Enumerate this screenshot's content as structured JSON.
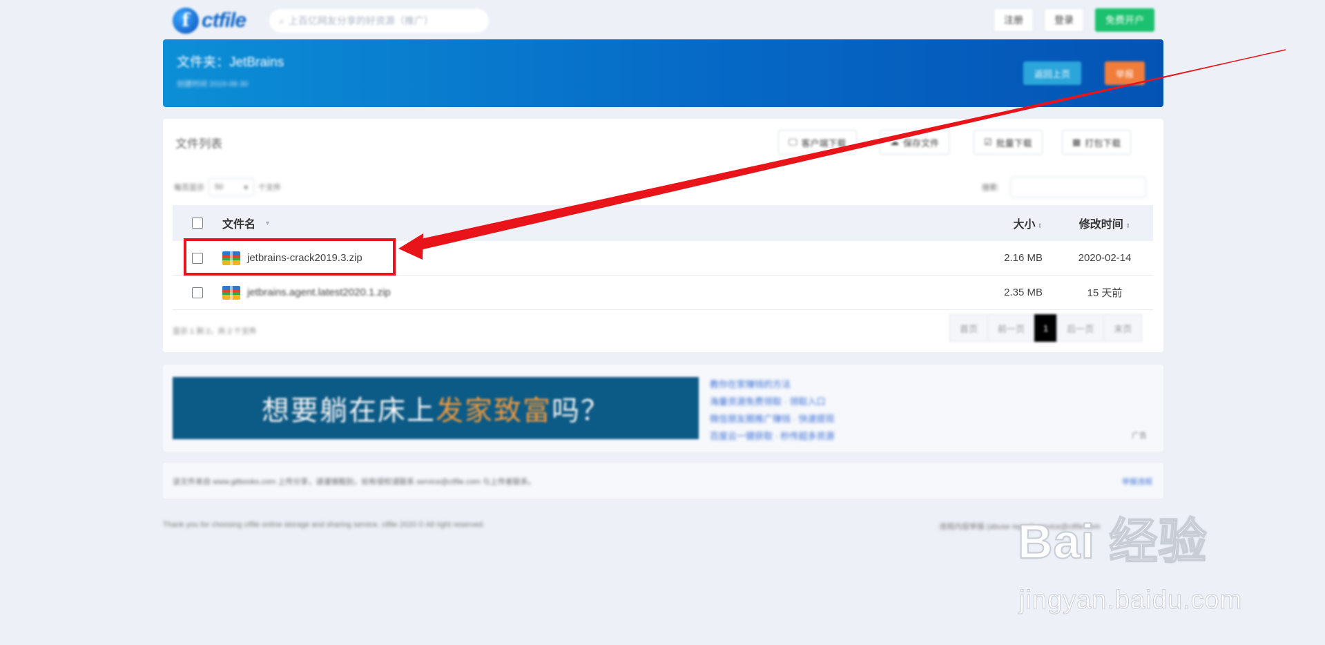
{
  "header": {
    "logo_letter": "f",
    "logo_text": "ctfile",
    "search_placeholder": "上百亿网友分享的好资源（推广）",
    "register_label": "注册",
    "login_label": "登录",
    "open_account_label": "免费开户"
  },
  "banner": {
    "title": "文件夹：JetBrains",
    "subtitle": "创建时间 2019-08-30",
    "back_label": "返回上页",
    "report_label": "举报"
  },
  "panel": {
    "title": "文件列表",
    "buttons": {
      "client_download": "客户端下载",
      "save_file": "保存文件",
      "batch_download": "批量下载",
      "package_download": "打包下载"
    },
    "length_prefix": "每页显示",
    "length_value": "50",
    "length_suffix": "个文件",
    "search_label": "搜索:"
  },
  "table": {
    "headers": {
      "name": "文件名",
      "size": "大小",
      "date": "修改时间"
    },
    "rows": [
      {
        "name": "jetbrains-crack2019.3.zip",
        "size": "2.16 MB",
        "date": "2020-02-14"
      },
      {
        "name": "jetbrains.agent.latest2020.1.zip",
        "size": "2.35 MB",
        "date": "15 天前"
      }
    ]
  },
  "pagination": {
    "info": "显示 1 到 2，共 2 个文件",
    "first": "首页",
    "prev": "前一页",
    "current": "1",
    "next": "后一页",
    "last": "末页"
  },
  "ad": {
    "text_a": "想要躺在床上",
    "text_highlight": "发家致富",
    "text_b": "吗？",
    "links": [
      "教你在家赚钱的方法",
      "海量资源免费领取 · 领取入口",
      "微信朋友圈推广赚钱 · 快速提现",
      "百度云一键获取 · 秒传超多资源"
    ],
    "tag": "广告"
  },
  "notice": {
    "text": "该文件来自 www.gitbooks.com 上传分享，请谨慎甄别，如有侵权请联系 service@ctfile.com 与上传者联系。",
    "link": "举报违规"
  },
  "footer": {
    "left": "Thank you for choosing ctfile online storage and sharing service. ctfile 2020 © All right reserved.",
    "right": "违规内容举报 (abuse report)  service@ctfile.com"
  },
  "watermark": {
    "main": "Bai 经验",
    "sub": "jingyan.baidu.com"
  },
  "colors": {
    "accent_green": "#1bc16e",
    "banner_blue": "#0669c6",
    "report_orange": "#f07d3a",
    "highlight_red": "#e8141a"
  }
}
